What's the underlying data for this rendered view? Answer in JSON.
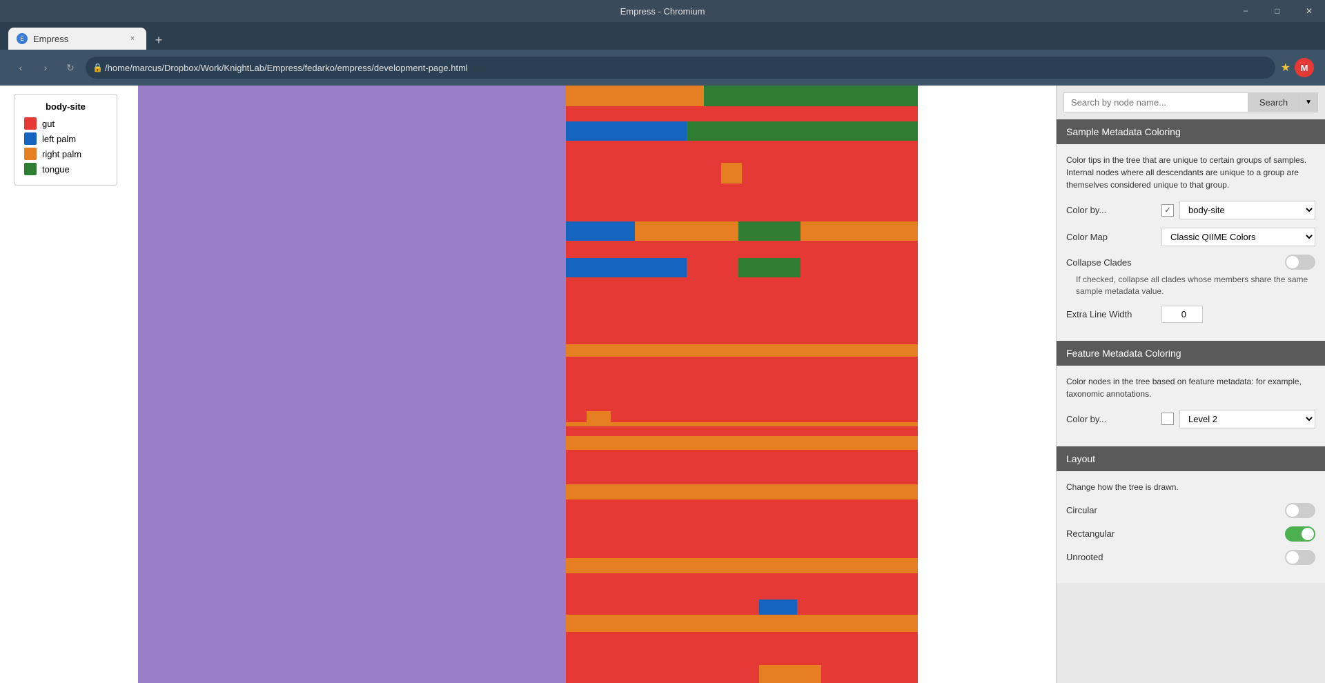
{
  "window": {
    "title": "Empress - Chromium",
    "min_btn": "−",
    "max_btn": "□",
    "close_btn": "✕"
  },
  "tab": {
    "favicon_letter": "E",
    "label": "Empress",
    "close": "×"
  },
  "new_tab_btn": "+",
  "addressbar": {
    "nav_back": "‹",
    "nav_forward": "›",
    "nav_refresh": "↻",
    "url": "/home/marcus/Dropbox/Work/KnightLab/Empress/fedarko/empress/development-page.html",
    "url_icon": "🔒",
    "star": "★",
    "avatar_letter": "M"
  },
  "legend": {
    "title": "body-site",
    "items": [
      {
        "label": "gut",
        "color": "#e53935"
      },
      {
        "label": "left palm",
        "color": "#1565c0"
      },
      {
        "label": "right palm",
        "color": "#e67e22"
      },
      {
        "label": "tongue",
        "color": "#2e7d32"
      }
    ]
  },
  "right_panel": {
    "search_placeholder": "Search by node name...",
    "search_btn": "Search",
    "search_dropdown": "▼",
    "sample_metadata_section": {
      "header": "Sample Metadata Coloring",
      "description": "Color tips in the tree that are unique to certain groups of samples. Internal nodes where all descendants are unique to a group are themselves considered unique to that group.",
      "color_by_label": "Color by...",
      "color_by_value": "body-site",
      "color_map_label": "Color Map",
      "color_map_value": "Classic QIIME Colors",
      "collapse_clades_label": "Collapse Clades",
      "collapse_desc": "If checked, collapse all clades whose members share the same sample metadata value.",
      "extra_line_width_label": "Extra Line Width",
      "extra_line_width_value": "0"
    },
    "feature_metadata_section": {
      "header": "Feature Metadata Coloring",
      "description": "Color nodes in the tree based on feature metadata: for example, taxonomic annotations.",
      "color_by_label": "Color by...",
      "color_by_value": "Level 2"
    },
    "layout_section": {
      "header": "Layout",
      "description": "Change how the tree is drawn.",
      "circular_label": "Circular",
      "rectangular_label": "Rectangular",
      "unrooted_label": "Unrooted"
    }
  },
  "colors": {
    "purple": "#9b7ec8",
    "red": "#e53935",
    "orange": "#e67e22",
    "blue": "#1565c0",
    "green": "#2e7d32",
    "dark_green": "#1b5e20"
  }
}
